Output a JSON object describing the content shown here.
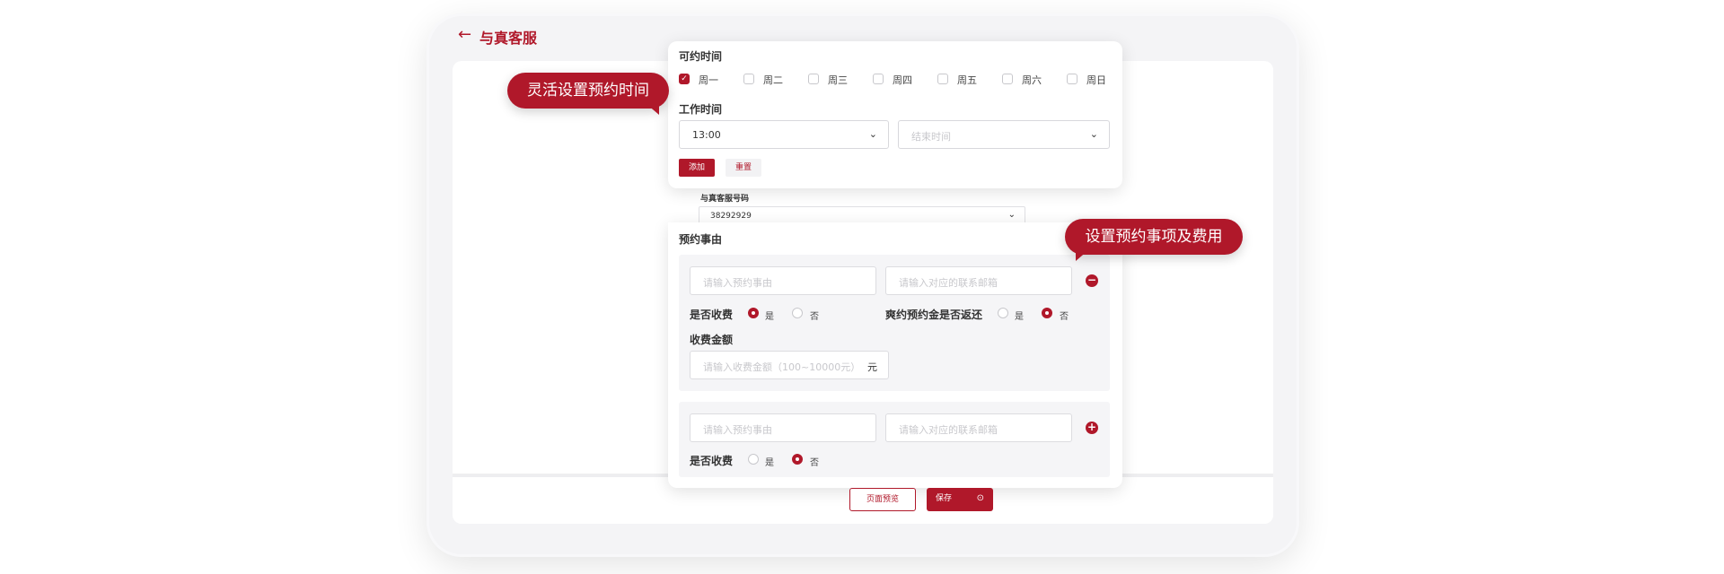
{
  "header": {
    "title": "与真客服",
    "back_icon": "arrow-left-icon"
  },
  "availability": {
    "title": "可约时间",
    "days": [
      {
        "label": "周一",
        "checked": true
      },
      {
        "label": "周二",
        "checked": false
      },
      {
        "label": "周三",
        "checked": false
      },
      {
        "label": "周四",
        "checked": false
      },
      {
        "label": "周五",
        "checked": false
      },
      {
        "label": "周六",
        "checked": false
      },
      {
        "label": "周日",
        "checked": false
      }
    ],
    "work_time_label": "工作时间",
    "start_time": "13:00",
    "end_time_placeholder": "结束时间",
    "add_button": "添加",
    "reset_button": "重置"
  },
  "phone": {
    "label": "与真客服号码",
    "value": "38292929"
  },
  "reasons": {
    "title": "预约事由",
    "reason_placeholder": "请输入预约事由",
    "email_placeholder": "请输入对应的联系邮箱",
    "charge_label": "是否收费",
    "yes": "是",
    "no": "否",
    "refund_label": "爽约预约金是否返还",
    "amount_label": "收费金额",
    "amount_placeholder": "请输入收费金额（100~10000元）",
    "amount_unit": "元",
    "item1": {
      "charge": "是",
      "refund": "否"
    },
    "item2": {
      "charge": "否"
    }
  },
  "footer": {
    "preview_button": "页面预览",
    "save_button": "保存"
  },
  "callouts": {
    "left": "灵活设置预约时间",
    "right": "设置预约事项及费用"
  },
  "colors": {
    "accent": "#b0182a",
    "panel": "#f5f5f7"
  }
}
